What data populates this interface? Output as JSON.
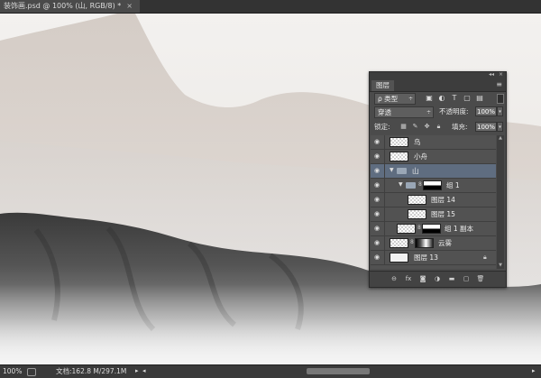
{
  "document": {
    "tab_title": "装饰画.psd @ 100% (山, RGB/8) *",
    "close_symbol": "×"
  },
  "statusbar": {
    "zoom": "100%",
    "doc_size": "文档:162.8 M/297.1M",
    "arrow": "▸",
    "scroll_left": "◂",
    "scroll_right": "▸"
  },
  "layers_panel": {
    "collapse": "◂◂",
    "close": "×",
    "tab_label": "图层",
    "menu_icon": "≡",
    "filter": {
      "value": "ρ 类型",
      "dropdown_symbol": "÷",
      "icons": [
        "image-filter-icon",
        "adjustment-filter-icon",
        "type-filter-icon",
        "shape-filter-icon",
        "smart-object-filter-icon"
      ]
    },
    "blend": {
      "value": "穿透",
      "dropdown_symbol": "÷",
      "opacity_label": "不透明度:",
      "opacity_value": "100%",
      "dd": "▾"
    },
    "lock": {
      "label": "锁定:",
      "fill_label": "填充:",
      "fill_value": "100%",
      "dd": "▾"
    },
    "layers": [
      {
        "name": "鸟"
      },
      {
        "name": "小舟"
      },
      {
        "name": "山"
      },
      {
        "name": "组 1"
      },
      {
        "name": "图层 14"
      },
      {
        "name": "图层 15"
      },
      {
        "name": "组 1 副本"
      },
      {
        "name": "云雾"
      },
      {
        "name": "图层 13"
      }
    ]
  },
  "colors": {
    "panel_bg": "#4b4b4b",
    "selected_row": "#5f6d80",
    "canvas_sky": "#eeecea"
  }
}
